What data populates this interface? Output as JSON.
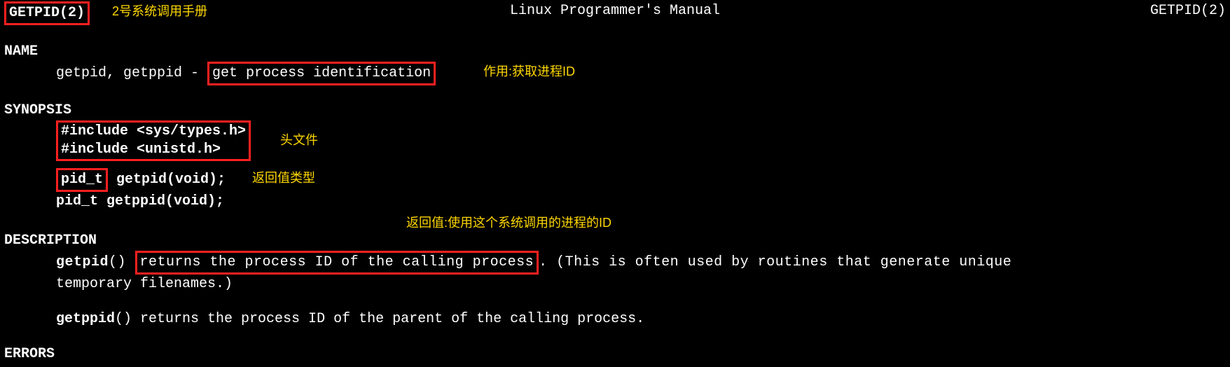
{
  "header": {
    "left": "GETPID(2)",
    "center": "Linux Programmer's Manual",
    "right": "GETPID(2)"
  },
  "annotations": {
    "section_manual": "2号系统调用手册",
    "purpose": "作用:获取进程ID",
    "header_files": "头文件",
    "return_type": "返回值类型",
    "return_value": "返回值:使用这个系统调用的进程的ID"
  },
  "sections": {
    "name": {
      "heading": "NAME",
      "prefix": "getpid, getppid - ",
      "highlighted": "get process identification"
    },
    "synopsis": {
      "heading": "SYNOPSIS",
      "include1": "#include <sys/types.h>",
      "include2": "#include <unistd.h>",
      "proto1_ret": "pid_t",
      "proto1_rest": " getpid(void);",
      "proto2": "pid_t getppid(void);"
    },
    "description": {
      "heading": "DESCRIPTION",
      "getpid_fn": "getpid",
      "getpid_paren": "() ",
      "getpid_highlight": "returns  the  process  ID of the calling process",
      "getpid_rest1": ".  (This is often used by routines that generate unique",
      "getpid_line2": "temporary filenames.)",
      "getppid_fn": "getppid",
      "getppid_rest": "() returns the process ID of the parent of the calling process."
    },
    "errors": {
      "heading": "ERRORS"
    }
  }
}
